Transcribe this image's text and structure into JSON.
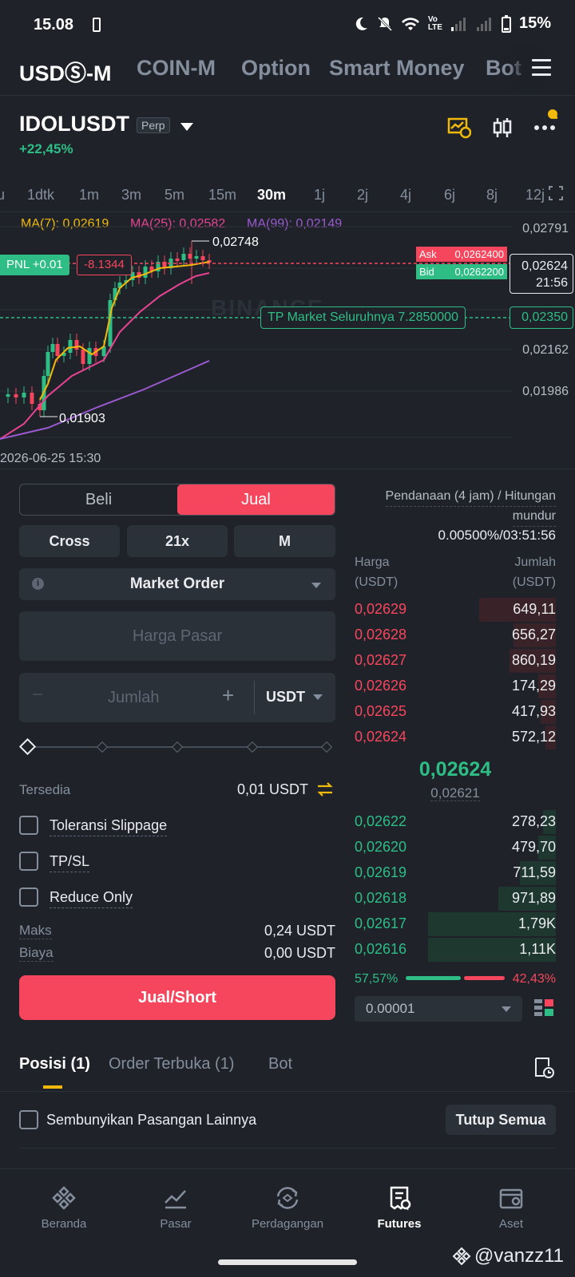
{
  "status": {
    "time": "15.08",
    "battery": "15%"
  },
  "topnav": {
    "tabs": [
      "USDⓈ-M",
      "COIN-M",
      "Option",
      "Smart Money",
      "Bot"
    ]
  },
  "pair": {
    "symbol": "IDOLUSDT",
    "type": "Perp",
    "change": "+22,45%"
  },
  "intervals": [
    "u",
    "1dtk",
    "1m",
    "3m",
    "5m",
    "15m",
    "30m",
    "1j",
    "2j",
    "4j",
    "6j",
    "8j",
    "12j"
  ],
  "active_interval": "30m",
  "ma": {
    "ma7": "MA(7): 0,02619",
    "ma25": "MA(25): 0,02582",
    "ma99": "MA(99): 0,02149"
  },
  "chart": {
    "y_labels": [
      "0,02791",
      "0,02162",
      "0,01986"
    ],
    "high_label": "0,02748",
    "low_label": "0,01903",
    "pnl": "PNL +0.01",
    "pnl_value": "-8.1344",
    "ask_label": "Ask",
    "ask_value": "0,0262400",
    "bid_label": "Bid",
    "bid_value": "0,0262200",
    "last_price": "0,02624",
    "countdown": "21:56",
    "tp_label": "TP Market Seluruhnya 7.2850000",
    "tp_price": "0,02350",
    "date": "2026-06-25 15:30",
    "watermark": "BINANCE",
    "colors": {
      "up": "#2ebd85",
      "down": "#f6465d",
      "ma7": "#f0b90b",
      "ma25": "#e84393",
      "ma99": "#9b59d0"
    }
  },
  "form": {
    "buy": "Beli",
    "sell": "Jual",
    "margin": "Cross",
    "leverage": "21x",
    "asset_mode": "M",
    "order_type": "Market Order",
    "price_placeholder": "Harga Pasar",
    "amount_placeholder": "Jumlah",
    "currency": "USDT",
    "available_label": "Tersedia",
    "available_value": "0,01 USDT",
    "slippage": "Toleransi Slippage",
    "tpsl": "TP/SL",
    "reduce_only": "Reduce Only",
    "max_label": "Maks",
    "max_value": "0,24 USDT",
    "fee_label": "Biaya",
    "fee_value": "0,00 USDT",
    "submit": "Jual/Short"
  },
  "funding": {
    "label_line1": "Pendanaan (4 jam) / Hitungan",
    "label_line2": "mundur",
    "value": "0.00500%/03:51:56"
  },
  "orderbook": {
    "price_header": "Harga",
    "price_unit": "(USDT)",
    "amount_header": "Jumlah",
    "amount_unit": "(USDT)",
    "asks": [
      [
        "0,02629",
        "649,11"
      ],
      [
        "0,02628",
        "656,27"
      ],
      [
        "0,02627",
        "860,19"
      ],
      [
        "0,02626",
        "174,29"
      ],
      [
        "0,02625",
        "417,93"
      ],
      [
        "0,02624",
        "572,12"
      ]
    ],
    "ask_depth": [
      0.6,
      0.33,
      0.36,
      0.14,
      0.12,
      0.08
    ],
    "mid_price": "0,02624",
    "mark_price": "0,02621",
    "bids": [
      [
        "0,02622",
        "278,23"
      ],
      [
        "0,02620",
        "479,70"
      ],
      [
        "0,02619",
        "711,59"
      ],
      [
        "0,02618",
        "971,89"
      ],
      [
        "0,02617",
        "1,79K"
      ],
      [
        "0,02616",
        "1,11K"
      ]
    ],
    "bid_depth": [
      0.1,
      0.14,
      0.28,
      0.45,
      1.0,
      1.0
    ],
    "buy_ratio": "57,57%",
    "sell_ratio": "42,43%",
    "buy_fraction": 0.5757,
    "precision": "0.00001"
  },
  "positions": {
    "tabs": [
      "Posisi (1)",
      "Order Terbuka (1)",
      "Bot"
    ],
    "hide_others": "Sembunyikan Pasangan Lainnya",
    "close_all": "Tutup Semua"
  },
  "nav": {
    "items": [
      "Beranda",
      "Pasar",
      "Perdagangan",
      "Futures",
      "Aset"
    ]
  },
  "watermark": "@vanzz11"
}
